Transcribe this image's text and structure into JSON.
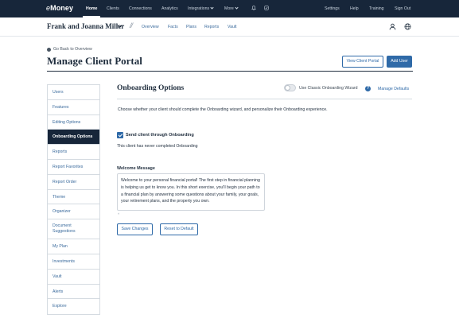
{
  "topnav": {
    "logo_prefix": "e",
    "logo_text": "Money",
    "items": [
      {
        "label": "Home",
        "active": true
      },
      {
        "label": "Clients"
      },
      {
        "label": "Connections"
      },
      {
        "label": "Analytics"
      },
      {
        "label": "Integrations"
      },
      {
        "label": "More"
      }
    ],
    "right_items": [
      {
        "label": "Settings"
      },
      {
        "label": "Help"
      },
      {
        "label": "Training"
      },
      {
        "label": "Sign Out"
      }
    ],
    "icons": [
      "bell-icon",
      "checklist-icon"
    ],
    "background_color": "#17263a"
  },
  "client_header": {
    "client_name": "Frank and Joanna Miller",
    "separator": "//",
    "tabs": [
      "Overview",
      "Facts",
      "Plans",
      "Reports",
      "Vault"
    ],
    "icons": [
      "user-icon",
      "globe-icon"
    ]
  },
  "page": {
    "back_link": "Go Back to Overview",
    "title": "Manage Client Portal",
    "view_portal_button": "View Client Portal",
    "add_user_button": "Add User",
    "accent_color": "#2f6aa8"
  },
  "sidebar": {
    "items": [
      {
        "label": "Users"
      },
      {
        "label": "Features"
      },
      {
        "label": "Editing Options"
      },
      {
        "label": "Onboarding Options",
        "active": true
      },
      {
        "label": "Reports"
      },
      {
        "label": "Report Favorites"
      },
      {
        "label": "Report Order"
      },
      {
        "label": "Theme"
      },
      {
        "label": "Organizer"
      },
      {
        "label": "Document Suggestions",
        "lines": [
          "Document",
          "Suggestions"
        ]
      },
      {
        "label": "My Plan"
      },
      {
        "label": "Investments"
      },
      {
        "label": "Vault"
      },
      {
        "label": "Alerts"
      },
      {
        "label": "Explore"
      }
    ]
  },
  "onboarding": {
    "section_title": "Onboarding Options",
    "classic_wizard_label": "Use Classic Onboarding Wizard",
    "classic_wizard_on": false,
    "manage_defaults_link": "Manage Defaults",
    "description": "Choose whether your client should complete the Onboarding wizard, and personalize their Onboarding experience.",
    "send_checkbox_label": "Send client through Onboarding",
    "send_checked": true,
    "status": "This client has never completed Onboarding",
    "welcome_label": "Welcome Message",
    "welcome_message": "Welcome to your personal financial portal! The first step in financial planning is helping us get to know you. In this short exercise, you'll begin your path to a financial plan by answering some questions about your family, your goals, your retirement plans, and the property you own.",
    "save_button": "Save Changes",
    "reset_button": "Reset to Default"
  }
}
